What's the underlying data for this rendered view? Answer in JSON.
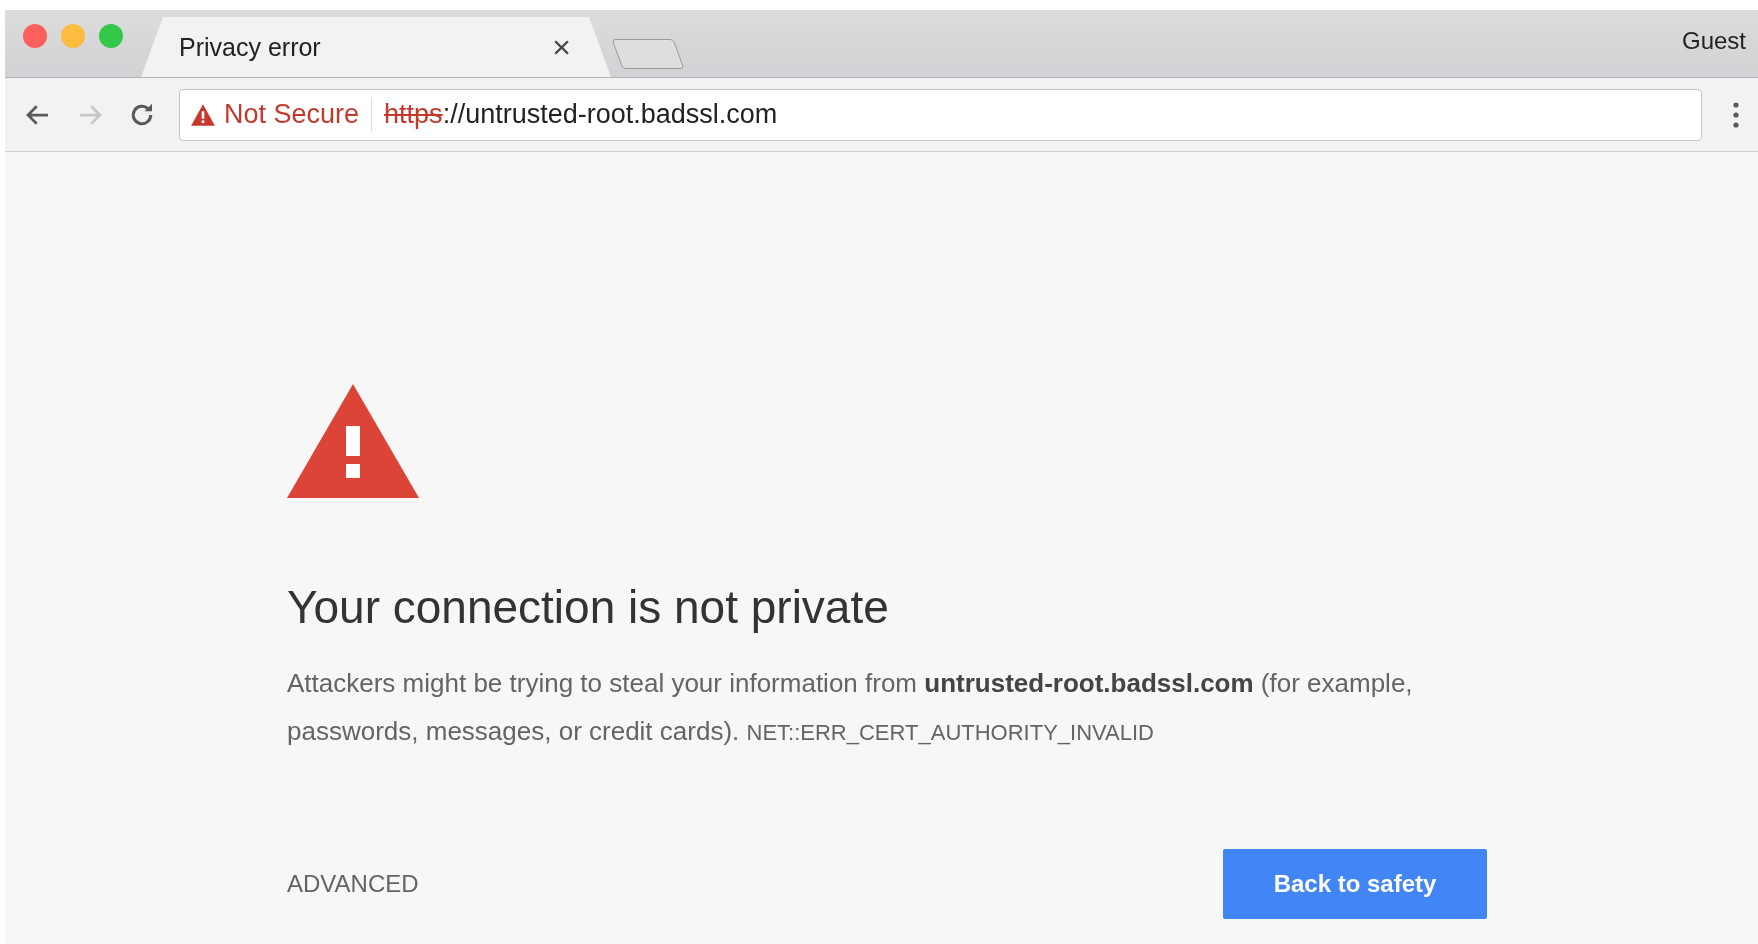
{
  "window_controls": [
    {
      "color": "#fc605c"
    },
    {
      "color": "#fdbc40"
    },
    {
      "color": "#34c84a"
    }
  ],
  "tabs": [
    {
      "title": "Privacy error",
      "close": "×",
      "selected": true
    }
  ],
  "profile": "Guest",
  "toolbar": {
    "forward_disabled": true
  },
  "address_bar": {
    "security_label": "Not Secure",
    "secure": false,
    "scheme": "https",
    "rest": "://untrusted-root.badssl.com"
  },
  "page": {
    "heading": "Your connection is not private",
    "description": "Attackers might be trying to steal your information from **untrusted-root.badssl.com** (for example, passwords, messages, or credit cards).",
    "error_code": "NET::ERR_CERT_AUTHORITY_INVALID",
    "advanced": "ADVANCED",
    "primary_button": "Back to safety"
  }
}
